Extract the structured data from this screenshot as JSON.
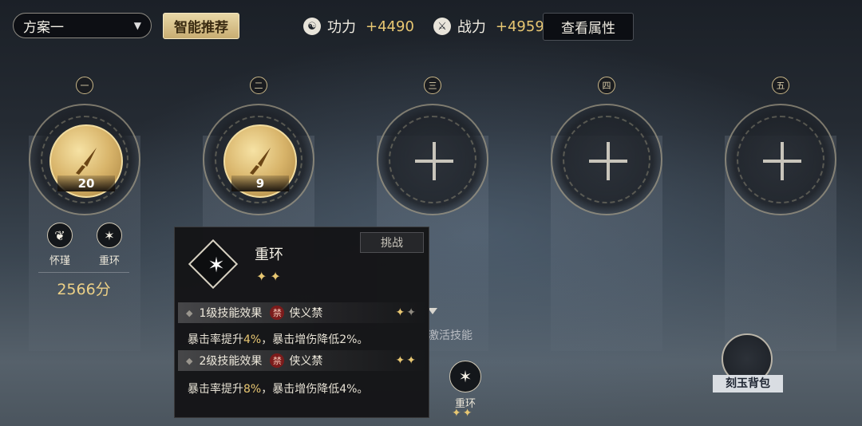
{
  "header": {
    "plan_value": "方案一",
    "recommend_label": "智能推荐",
    "stats": [
      {
        "label": "功力",
        "value": "+4490"
      },
      {
        "label": "战力",
        "value": "+4959"
      }
    ],
    "view_attr_label": "查看属性"
  },
  "slots": [
    {
      "num": "一",
      "level": "20"
    },
    {
      "num": "二",
      "level": "9"
    },
    {
      "num": "三"
    },
    {
      "num": "四"
    },
    {
      "num": "五"
    }
  ],
  "slot1": {
    "skills": [
      {
        "label": "怀瑾"
      },
      {
        "label": "重环"
      }
    ],
    "score": "2566分"
  },
  "tooltip": {
    "title": "重环",
    "tag": "挑战",
    "levels": [
      {
        "head": "1级技能效果",
        "ban": "禁",
        "sect": "侠义禁",
        "desc_a": "暴击率提升",
        "desc_v1": "4%",
        "desc_b": "，暴击增伤降低2%。"
      },
      {
        "head": "2级技能效果",
        "ban": "禁",
        "sect": "侠义禁",
        "desc_a": "暴击率提升",
        "desc_v1": "8%",
        "desc_b": "，暴击增伤降低4%。"
      }
    ]
  },
  "activate_text": "激活技能",
  "bottom_skill": {
    "label": "重环"
  },
  "bag": {
    "label": "刻玉背包"
  }
}
